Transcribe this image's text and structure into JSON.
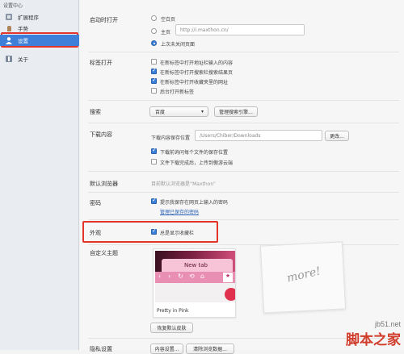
{
  "sidebar": {
    "title": "设置中心",
    "items": [
      {
        "label": "扩展程序",
        "icon": "extension-icon"
      },
      {
        "label": "手势",
        "icon": "gesture-icon"
      },
      {
        "label": "设置",
        "icon": "user-icon",
        "active": true
      },
      {
        "label": "关于",
        "icon": "about-icon"
      }
    ]
  },
  "startup": {
    "label": "启动时打开",
    "options": [
      "空白页",
      "主页",
      "上次未关闭页面"
    ],
    "homepage_value": "http://i.maxthon.cn/",
    "selected": "上次未关闭页面"
  },
  "tabs": {
    "label": "标签打开",
    "options": [
      {
        "text": "在新标签中打开地址栏输入的内容",
        "checked": false
      },
      {
        "text": "在新标签中打开搜索栏搜索结果页",
        "checked": true
      },
      {
        "text": "在新标签中打开收藏夹里的网址",
        "checked": true
      },
      {
        "text": "后台打开新标签",
        "checked": false
      }
    ]
  },
  "search": {
    "label": "搜索",
    "engine": "百度",
    "manage_button": "管理搜索引擎..."
  },
  "download": {
    "label": "下载内容",
    "location_label": "下载内容保存位置",
    "path": "/Users/Chiber/Downloads",
    "change_button": "更改...",
    "options": [
      {
        "text": "下载前询问每个文件的保存位置",
        "checked": true
      },
      {
        "text": "文件下载完成后，上传到傲游云端",
        "checked": false
      }
    ]
  },
  "default_browser": {
    "label": "默认浏览器",
    "status": "目前默认浏览器是“Maxthon”"
  },
  "password": {
    "label": "密码",
    "option": {
      "text": "提示我保存在网页上输入的密码",
      "checked": true
    },
    "manage_link": "管理已保存的密码"
  },
  "appearance": {
    "label": "外观",
    "option": {
      "text": "总是显示收藏栏",
      "checked": true
    }
  },
  "custom_theme": {
    "label": "自定义主题",
    "theme_name": "Pretty in Pink",
    "new_tab_text": "New tab",
    "more_text": "more!",
    "reset_button": "恢复默认皮肤"
  },
  "privacy": {
    "label": "隐私设置",
    "button1": "内容设置...",
    "button2": "清除浏览数据..."
  },
  "watermark": {
    "top": "jb51.net",
    "bottom": "脚本之家"
  },
  "colors": {
    "accent": "#3d7fd9",
    "highlight_box": "#e2342b"
  }
}
